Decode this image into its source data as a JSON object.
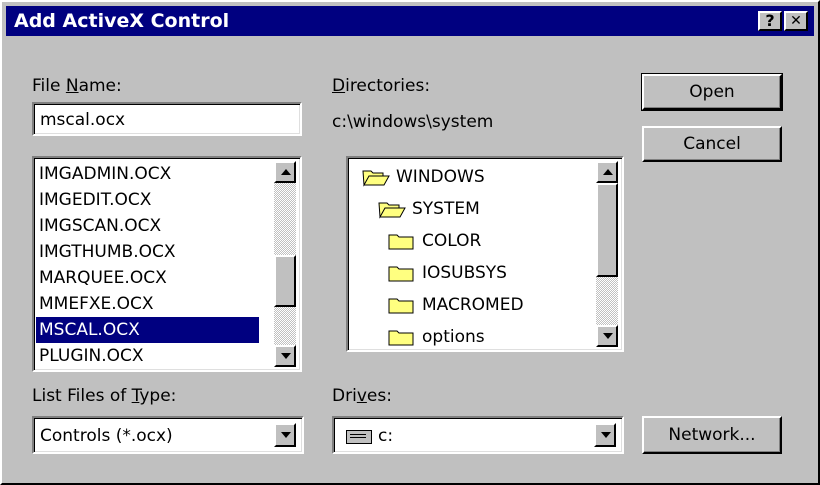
{
  "window": {
    "title": "Add ActiveX Control",
    "help_glyph": "?",
    "close_glyph": "✕"
  },
  "file_name": {
    "label_pre": "File ",
    "label_u": "N",
    "label_post": "ame:",
    "value": "mscal.ocx"
  },
  "files": {
    "items": [
      {
        "label": "IMGADMIN.OCX"
      },
      {
        "label": "IMGEDIT.OCX"
      },
      {
        "label": "IMGSCAN.OCX"
      },
      {
        "label": "IMGTHUMB.OCX"
      },
      {
        "label": "MARQUEE.OCX"
      },
      {
        "label": "MMEFXE.OCX"
      },
      {
        "label": "MSCAL.OCX"
      },
      {
        "label": "PLUGIN.OCX"
      }
    ],
    "selected_label": "MSCAL.OCX"
  },
  "directories": {
    "label_u": "D",
    "label_post": "irectories:",
    "path": "c:\\windows\\system",
    "items": [
      {
        "label": "WINDOWS",
        "icon": "open-folder-icon"
      },
      {
        "label": "SYSTEM",
        "icon": "open-folder-icon"
      },
      {
        "label": "COLOR",
        "icon": "folder-icon"
      },
      {
        "label": "IOSUBSYS",
        "icon": "folder-icon"
      },
      {
        "label": "MACROMED",
        "icon": "folder-icon"
      },
      {
        "label": "options",
        "icon": "folder-icon"
      }
    ]
  },
  "file_type": {
    "label_pre": "List Files of ",
    "label_u": "T",
    "label_post": "ype:",
    "value": "Controls (*.ocx)"
  },
  "drives": {
    "label_pre": "Dri",
    "label_u": "v",
    "label_post": "es:",
    "value": "c:",
    "icon": "drive-icon"
  },
  "buttons": {
    "open": "Open",
    "cancel": "Cancel",
    "network": "Network..."
  }
}
